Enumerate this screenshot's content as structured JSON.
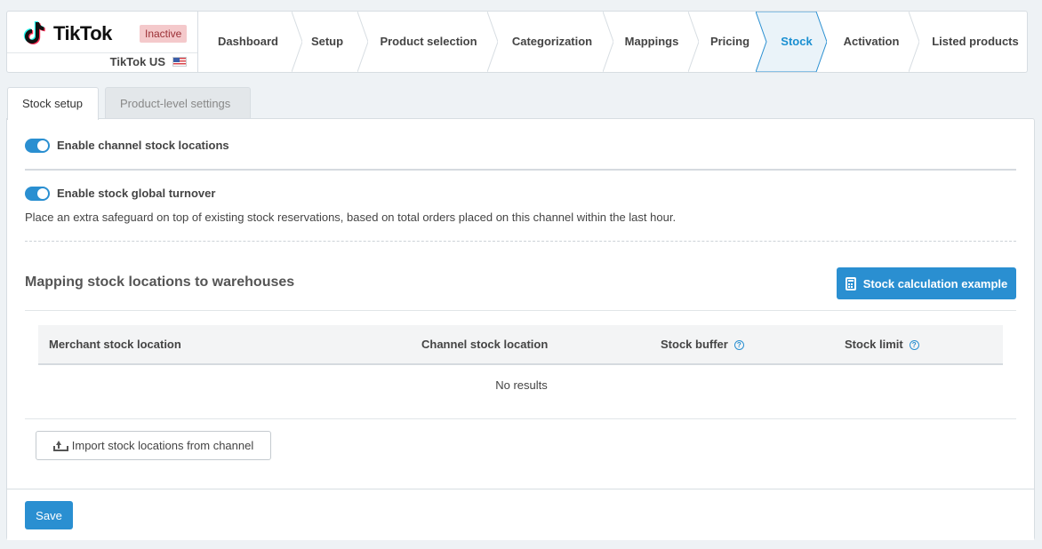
{
  "brand": {
    "name": "TikTok",
    "status": "Inactive",
    "channel": "TikTok US",
    "flag_icon": "us-flag-icon"
  },
  "steps": [
    {
      "label": "Dashboard"
    },
    {
      "label": "Setup"
    },
    {
      "label": "Product selection"
    },
    {
      "label": "Categorization"
    },
    {
      "label": "Mappings"
    },
    {
      "label": "Pricing"
    },
    {
      "label": "Stock",
      "active": true
    },
    {
      "label": "Activation"
    },
    {
      "label": "Listed products"
    }
  ],
  "tabs": {
    "stock_setup": "Stock setup",
    "product_level": "Product-level settings"
  },
  "settings": {
    "channel_locations": {
      "label": "Enable channel stock locations",
      "enabled": true
    },
    "global_turnover": {
      "label": "Enable stock global turnover",
      "enabled": true,
      "description": "Place an extra safeguard on top of existing stock reservations, based on total orders placed on this channel within the last hour."
    }
  },
  "mapping": {
    "title": "Mapping stock locations to warehouses",
    "calc_button": "Stock calculation example",
    "columns": [
      "Merchant stock location",
      "Channel stock location",
      "Stock buffer",
      "Stock limit"
    ],
    "empty_text": "No results",
    "import_button": "Import stock locations from channel"
  },
  "footer": {
    "save_label": "Save"
  },
  "colors": {
    "accent": "#2a8fd1",
    "badge_bg": "#f4c9cb",
    "badge_text": "#9b2f35"
  }
}
